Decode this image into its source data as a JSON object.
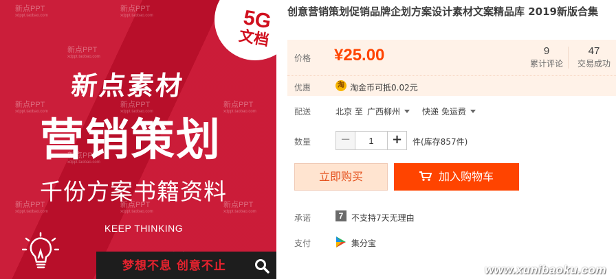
{
  "product_image": {
    "badge_big": "5G",
    "badge_small": "文档",
    "brand": "新点素材",
    "headline": "营销策划",
    "subline": "千份方案书籍资料",
    "tagline": "KEEP THINKING",
    "slogan": "梦想不息  创意不止",
    "watermark_cn": "新点PPT",
    "watermark_url": "xdppt.taobao.com",
    "colors": {
      "background": "#c8102e",
      "badge_text": "#d0101e",
      "slogan": "#e6222e"
    }
  },
  "product": {
    "title": "创意营销策划促销品牌企划方案设计素材文案精品库 2019新版合集",
    "price_label": "价格",
    "price": "¥25.00",
    "reviews_count": "9",
    "reviews_label": "累计评论",
    "sales_count": "47",
    "sales_label": "交易成功"
  },
  "promo": {
    "label": "优惠",
    "icon_char": "淘",
    "text": "淘金币可抵0.02元"
  },
  "shipping": {
    "label": "配送",
    "from": "北京 至",
    "to": "广西柳州",
    "method": "快递 免运费"
  },
  "quantity": {
    "label": "数量",
    "minus": "−",
    "value": "1",
    "plus": "+",
    "stock": "件(库存857件)"
  },
  "actions": {
    "buy_now": "立即购买",
    "add_to_cart": "加入购物车"
  },
  "promise": {
    "label": "承诺",
    "icon_char": "7",
    "text": "不支持7天无理由"
  },
  "payment": {
    "label": "支付",
    "text": "集分宝"
  },
  "site_watermark": "www.xunibaoku.com",
  "accent_colors": {
    "price": "#ff4400",
    "add_cart_bg": "#ff4400",
    "buy_now_bg": "#ffe4d0",
    "price_box_bg": "#fff2e8"
  }
}
